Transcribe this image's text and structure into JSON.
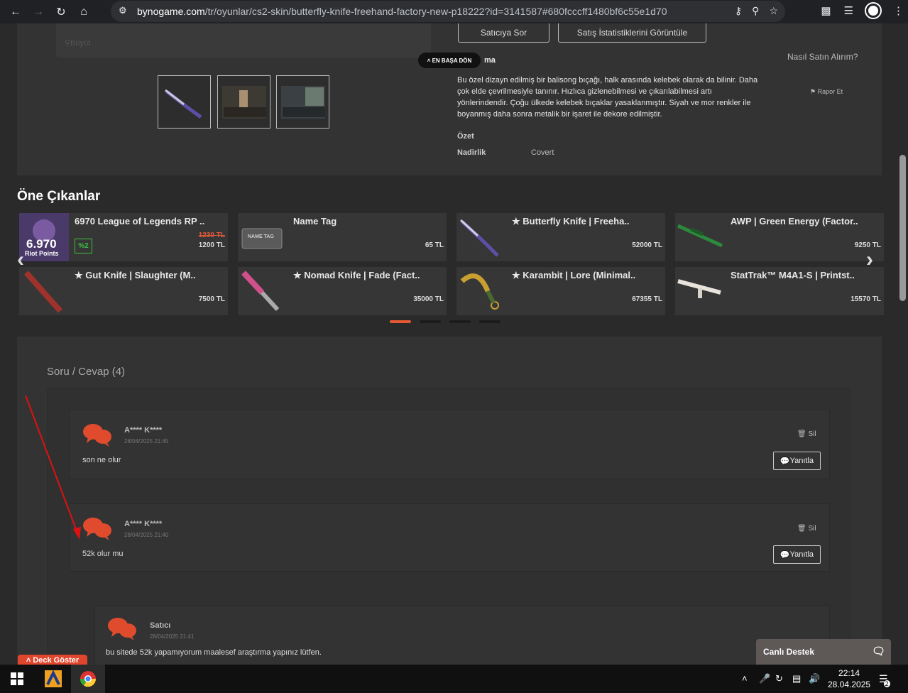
{
  "browser": {
    "url_host": "bynogame.com",
    "url_path": "/tr/oyunlar/cs2-skin/butterfly-knife-freehand-factory-new-p18222?id=3141587#680fcccff1480bf6c55e1d70"
  },
  "product": {
    "zoom_label": "Büyüt",
    "ask_seller": "Satıcıya Sor",
    "sales_stats": "Satış İstatistiklerini Görüntüle",
    "back_to_top": "EN BAŞA DÖN",
    "desc_title_partial": "ma",
    "how_to_buy": "Nasıl Satın Alırım?",
    "description": "Bu özel dizayn edilmiş bir balisong bıçağı, halk arasında kelebek olarak da bilinir. Daha çok elde çevrilmesiyle tanınır. Hızlıca gizlenebilmesi ve çıkarılabilmesi artı yönlerindendir. Çoğu ülkede kelebek bıçaklar yasaklanmıştır. Siyah ve mor renkler ile boyanmış daha sonra metalik bir işaret ile dekore edilmiştir.",
    "report": "Rapor Et",
    "summary_heading": "Özet",
    "rarity_key": "Nadirlik",
    "rarity_value": "Covert"
  },
  "featured": {
    "title": "Öne Çıkanlar",
    "cards": [
      {
        "name": "6970 League of Legends RP ..",
        "old_price": "1230 TL",
        "price": "1200 TL",
        "badge": "%2",
        "img_text": "6.970",
        "img_sub": "Riot Points"
      },
      {
        "name": "Name Tag",
        "price": "65 TL",
        "img_text": "NAME TAG"
      },
      {
        "name": "★ Butterfly Knife | Freeha..",
        "price": "52000 TL"
      },
      {
        "name": "AWP | Green Energy (Factor..",
        "price": "9250 TL"
      },
      {
        "name": "★ Gut Knife | Slaughter (M..",
        "price": "7500 TL"
      },
      {
        "name": "★ Nomad Knife | Fade (Fact..",
        "price": "35000 TL"
      },
      {
        "name": "★ Karambit | Lore (Minimal..",
        "price": "67355 TL"
      },
      {
        "name": "StatTrak™ M4A1-S | Printst..",
        "price": "15570 TL"
      }
    ]
  },
  "qa": {
    "title": "Soru / Cevap (4)",
    "comments": [
      {
        "author": "A**** K****",
        "date": "28/04/2025 21:45",
        "text": "son ne olur",
        "delete": "Sil",
        "reply": "Yanıtla"
      },
      {
        "author": "A**** K****",
        "date": "28/04/2025 21:40",
        "text": "52k olur mu",
        "delete": "Sil",
        "reply": "Yanıtla"
      },
      {
        "author": "Satıcı",
        "date": "28/04/2025 21:41",
        "text": "bu sitede 52k yapamıyorum maalesef araştırma yapınız lütfen."
      }
    ]
  },
  "deck_button": "Deck Göster",
  "live_support": "Canlı Destek",
  "taskbar": {
    "time": "22:14",
    "date": "28.04.2025",
    "notif_count": "2"
  },
  "colors": {
    "accent": "#e25a33",
    "annotation_arrow": "#e01010"
  }
}
